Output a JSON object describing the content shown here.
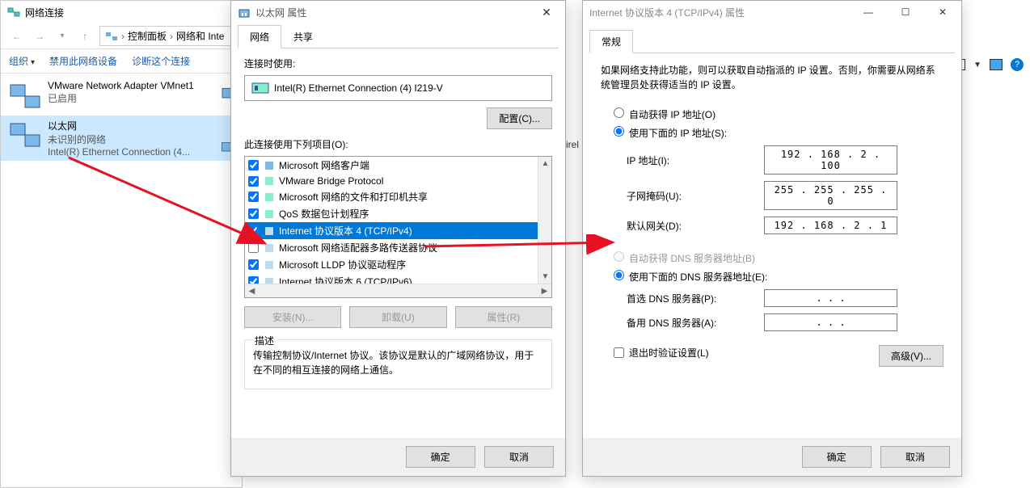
{
  "main": {
    "title": "网络连接",
    "breadcrumb": {
      "root": "控制面板",
      "sep": "›",
      "mid": "网络和 Inte"
    },
    "toolbar": {
      "org": "组织",
      "disable": "禁用此网络设备",
      "diag": "诊断这个连接"
    },
    "items": [
      {
        "name": "VMware Network Adapter VMnet1",
        "status": "已启用",
        "device": ""
      },
      {
        "name": "以太网",
        "status": "未识别的网络",
        "device": "Intel(R) Ethernet Connection (4..."
      }
    ]
  },
  "wireless_hint": "irel",
  "dlg1": {
    "title": "以太网 属性",
    "tabs": [
      "网络",
      "共享"
    ],
    "connect_using": "连接时使用:",
    "nic": "Intel(R) Ethernet Connection (4) I219-V",
    "configure": "配置(C)...",
    "items_label": "此连接使用下列项目(O):",
    "items": [
      {
        "chk": true,
        "label": "Microsoft 网络客户端"
      },
      {
        "chk": true,
        "label": "VMware Bridge Protocol"
      },
      {
        "chk": true,
        "label": "Microsoft 网络的文件和打印机共享"
      },
      {
        "chk": true,
        "label": "QoS 数据包计划程序"
      },
      {
        "chk": true,
        "label": "Internet 协议版本 4 (TCP/IPv4)",
        "hl": true
      },
      {
        "chk": false,
        "label": "Microsoft 网络适配器多路传送器协议"
      },
      {
        "chk": true,
        "label": "Microsoft LLDP 协议驱动程序"
      },
      {
        "chk": true,
        "label": "Internet 协议版本 6 (TCP/IPv6)"
      }
    ],
    "install": "安装(N)...",
    "uninstall": "卸载(U)",
    "prop": "属性(R)",
    "desc_legend": "描述",
    "desc": "传输控制协议/Internet 协议。该协议是默认的广域网络协议，用于在不同的相互连接的网络上通信。",
    "ok": "确定",
    "cancel": "取消"
  },
  "dlg2": {
    "title": "Internet 协议版本 4 (TCP/IPv4) 属性",
    "tab": "常规",
    "info": "如果网络支持此功能，则可以获取自动指派的 IP 设置。否则，你需要从网络系统管理员处获得适当的 IP 设置。",
    "r_auto_ip": "自动获得 IP 地址(O)",
    "r_use_ip": "使用下面的 IP 地址(S):",
    "ip_label": "IP 地址(I):",
    "ip_val": "192 . 168 .  2  . 100",
    "mask_label": "子网掩码(U):",
    "mask_val": "255 . 255 . 255 .  0",
    "gw_label": "默认网关(D):",
    "gw_val": "192 . 168 .  2  .  1",
    "r_auto_dns": "自动获得 DNS 服务器地址(B)",
    "r_use_dns": "使用下面的 DNS 服务器地址(E):",
    "dns1_label": "首选 DNS 服务器(P):",
    "dns1_val": ".       .       .",
    "dns2_label": "备用 DNS 服务器(A):",
    "dns2_val": ".       .       .",
    "validate": "退出时验证设置(L)",
    "advanced": "高级(V)...",
    "ok": "确定",
    "cancel": "取消"
  }
}
